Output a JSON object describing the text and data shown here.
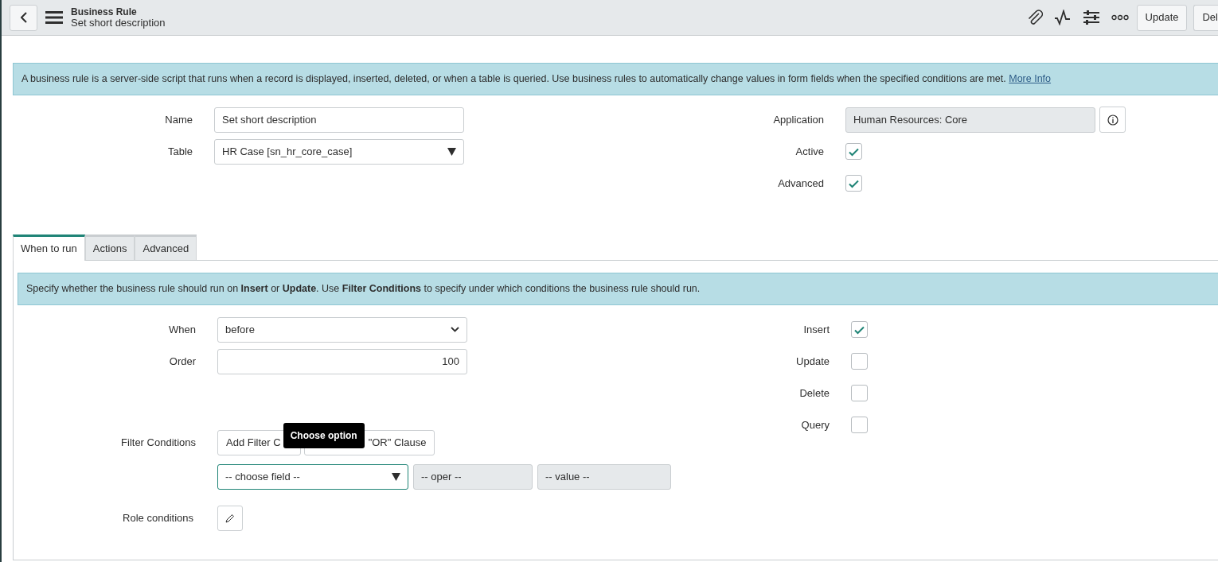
{
  "header": {
    "title": "Business Rule",
    "subtitle": "Set short description",
    "buttons": [
      "Update",
      "Del"
    ]
  },
  "info": {
    "text": "A business rule is a server-side script that runs when a record is displayed, inserted, deleted, or when a table is queried. Use business rules to automatically change values in form fields when the specified conditions are met.",
    "link": "More Info"
  },
  "fields_left": [
    {
      "kind": "text",
      "label": "Name",
      "value": "Set short description"
    },
    {
      "kind": "reference",
      "label": "Table",
      "value": "HR Case [sn_hr_core_case]"
    }
  ],
  "fields_right": [
    {
      "kind": "readonly",
      "label": "Application",
      "value": "Human Resources: Core"
    },
    {
      "kind": "checkbox",
      "label": "Active",
      "checked": true
    },
    {
      "kind": "checkbox",
      "label": "Advanced",
      "checked": true
    }
  ],
  "tabs": [
    {
      "label": "When to run",
      "selected": true
    },
    {
      "label": "Actions",
      "selected": false
    },
    {
      "label": "Advanced",
      "selected": false
    }
  ],
  "tab_info": "Specify whether the business rule should run on **Insert** or **Update**. Use **Filter Conditions** to specify under which conditions the business rule should run.",
  "when_left": [
    {
      "kind": "select",
      "label": "When",
      "value": "before"
    },
    {
      "kind": "number",
      "label": "Order",
      "value": "100"
    }
  ],
  "when_right": [
    {
      "label": "Insert",
      "checked": true
    },
    {
      "label": "Update",
      "checked": false
    },
    {
      "label": "Delete",
      "checked": false
    },
    {
      "label": "Query",
      "checked": false
    }
  ],
  "filter": {
    "label": "Filter Conditions",
    "buttons": [
      "Add Filter C",
      "\"OR\" Clause"
    ],
    "tooltip": "Choose option",
    "field": "-- choose field --",
    "oper": "-- oper --",
    "value": "-- value --"
  },
  "role": {
    "label": "Role conditions"
  }
}
